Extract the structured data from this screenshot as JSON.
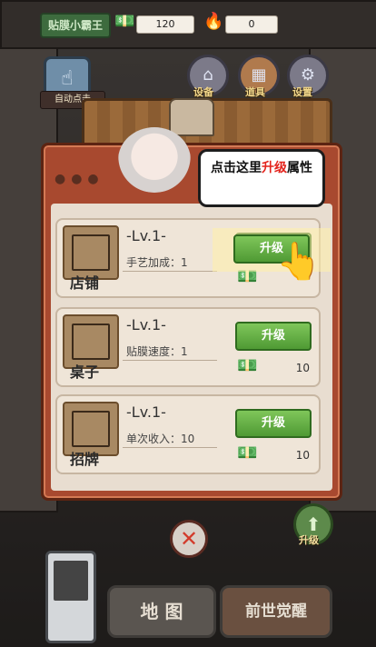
{
  "hud": {
    "title": "贴膜小霸王",
    "money": "120",
    "fire": "0"
  },
  "buttons": {
    "auto": "自动点击",
    "equipment": "设备",
    "tools": "道具",
    "settings": "设置",
    "side_upgrade": "升级"
  },
  "tutorial": {
    "prefix": "点击这里",
    "highlight": "升级",
    "suffix": "属性"
  },
  "rows": [
    {
      "name": "店铺",
      "level": "-Lv.1-",
      "stat": "手艺加成：1",
      "button": "升级",
      "cost": ""
    },
    {
      "name": "桌子",
      "level": "-Lv.1-",
      "stat": "贴膜速度：1",
      "button": "升级",
      "cost": "10"
    },
    {
      "name": "招牌",
      "level": "-Lv.1-",
      "stat": "单次收入：10",
      "button": "升级",
      "cost": "10"
    }
  ],
  "bottom": {
    "map": "地 图",
    "rebirth": "前世觉醒"
  },
  "colors": {
    "panel": "#a8492f",
    "upgrade_green": "#5aa83e",
    "highlight_red": "#e3231c"
  }
}
